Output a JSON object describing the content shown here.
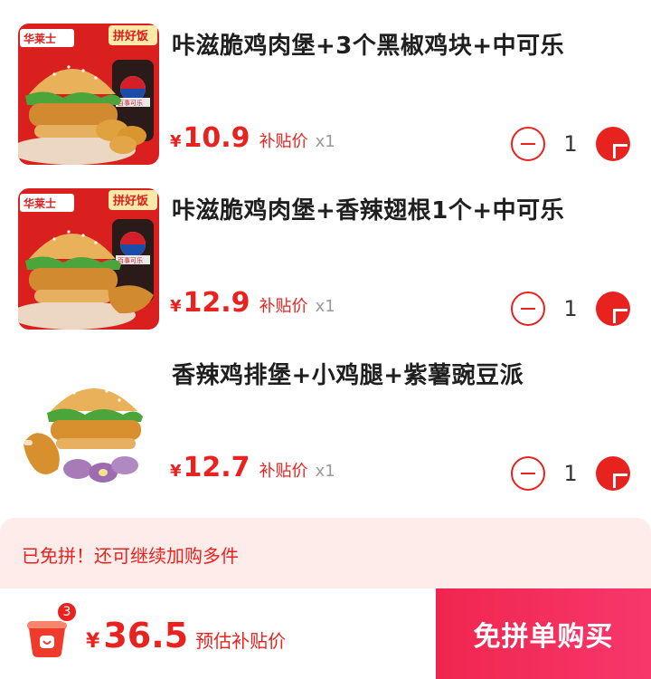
{
  "items": [
    {
      "title": "咔滋脆鸡肉堡+3个黑椒鸡块+中可乐",
      "yen": "¥",
      "price": "10.9",
      "subsidy_label": "补贴价",
      "multiplier": "x1",
      "quantity": "1",
      "image_badge": "拼好饭",
      "brand_logo": "华莱士",
      "drink_label": "百事可乐"
    },
    {
      "title": "咔滋脆鸡肉堡+香辣翅根1个+中可乐",
      "yen": "¥",
      "price": "12.9",
      "subsidy_label": "补贴价",
      "multiplier": "x1",
      "quantity": "1",
      "image_badge": "拼好饭",
      "brand_logo": "华莱士",
      "drink_label": "百事可乐"
    },
    {
      "title": "香辣鸡排堡+小鸡腿+紫薯豌豆派",
      "yen": "¥",
      "price": "12.7",
      "subsidy_label": "补贴价",
      "multiplier": "x1",
      "quantity": "1"
    }
  ],
  "notice": {
    "text": "已免拼！还可继续加购多件"
  },
  "bottom_bar": {
    "cart_count": "3",
    "yen": "¥",
    "total": "36.5",
    "total_note": "预估补贴价",
    "checkout_label": "免拼单购买"
  },
  "colors": {
    "accent": "#e8231f",
    "notice_bg": "#fdecea",
    "checkout_bg": "#f0264f"
  }
}
